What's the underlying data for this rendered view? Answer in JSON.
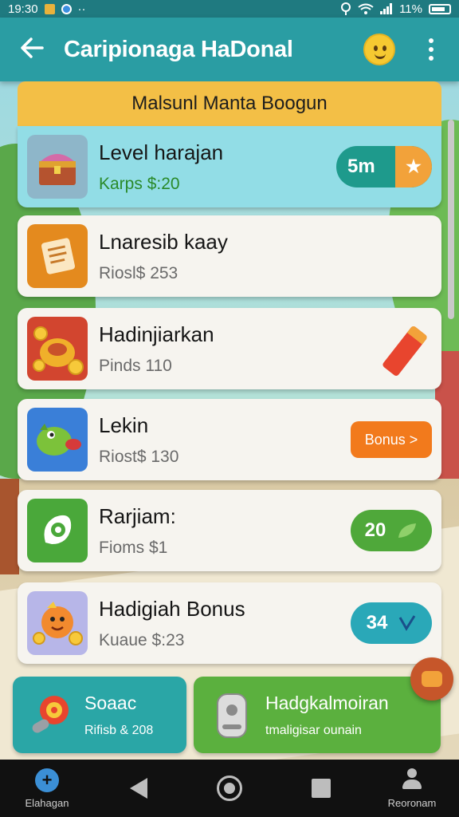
{
  "status_bar": {
    "time": "19:30",
    "signal_text": "11%"
  },
  "app_bar": {
    "title": "Caripionaga HaDonal",
    "back_icon": "arrow-left-icon",
    "emoji_icon": "smiley-icon",
    "menu_icon": "more-vertical-icon"
  },
  "panel": {
    "header": "Malsunl Manta Boogun"
  },
  "items": [
    {
      "name": "Level harajan",
      "sub": "Karps $:20",
      "badge": "5m",
      "badge_icon": "star-icon",
      "icon": "treasure-chest-icon"
    },
    {
      "name": "Lnaresib kaay",
      "sub": "Riosl$ 253",
      "icon": "scroll-icon"
    },
    {
      "name": "Hadinjiarkan",
      "sub": "Pinds 110",
      "icon": "coin-bag-icon",
      "side_icon": "crayon-icon"
    },
    {
      "name": "Lekin",
      "sub": "Riost$ 130",
      "badge": "Bonus >",
      "icon": "bird-icon"
    },
    {
      "name": "Rarjiam:",
      "sub": "Fioms $1",
      "badge": "20",
      "icon": "dollar-leaf-icon"
    },
    {
      "name": "Hadigiah Bonus",
      "sub": "Kuaue $:23",
      "badge": "34",
      "icon": "mascot-icon"
    }
  ],
  "cards": [
    {
      "title": "Soaac",
      "sub": "Rifisb & 208",
      "icon": "whistle-icon"
    },
    {
      "title": "Hadgkalmoiran",
      "sub": "tmaligisar ounain",
      "icon": "robot-icon"
    }
  ],
  "nav": [
    {
      "label": "Elahagan",
      "icon": "plus-circle-icon"
    },
    {
      "label": "",
      "icon": "back-triangle-icon"
    },
    {
      "label": "",
      "icon": "home-circle-icon"
    },
    {
      "label": "",
      "icon": "recents-square-icon"
    },
    {
      "label": "Reoronam",
      "icon": "person-icon"
    }
  ]
}
